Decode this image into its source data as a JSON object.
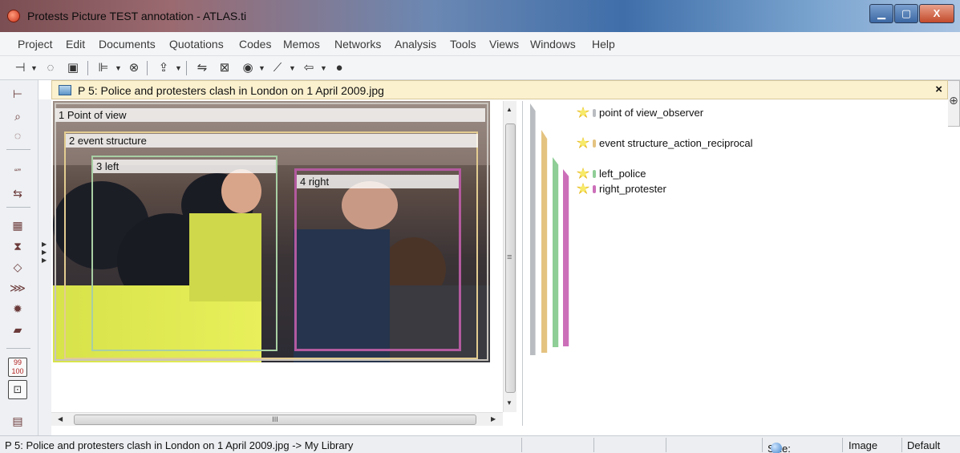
{
  "window": {
    "title": "Protests Picture TEST annotation - ATLAS.ti",
    "close_glyph": "X"
  },
  "menu": [
    "Project",
    "Edit",
    "Documents",
    "Quotations",
    "Codes",
    "Memos",
    "Networks",
    "Analysis",
    "Tools",
    "Views",
    "Windows",
    "Help"
  ],
  "document": {
    "title": "P 5: Police and protesters clash in London on 1 April 2009.jpg",
    "close": "×"
  },
  "regions": [
    {
      "label": "1 Point of view",
      "color": "#c9c4bd"
    },
    {
      "label": "2 event structure",
      "color": "#e3cc90"
    },
    {
      "label": "3 left",
      "color": "#a8cfa3"
    },
    {
      "label": "4 right",
      "color": "#b35a9f"
    }
  ],
  "codes": [
    {
      "label": "point of view_observer",
      "color": "#b9bcc0"
    },
    {
      "label": "event structure_action_reciprocal",
      "color": "#e4c381"
    },
    {
      "label": "left_police",
      "color": "#8fce96"
    },
    {
      "label": "right_protester",
      "color": "#cc6fb9"
    }
  ],
  "sidebar_counter": {
    "top": "99",
    "bottom": "100"
  },
  "scroll": {
    "h_grip": "III",
    "v_grip": "≡"
  },
  "status": {
    "path": "P 5: Police and protesters clash in London on 1 April 2009.jpg ->  My Library",
    "size": "Size: 100%",
    "type": "Image",
    "mode": "Default"
  }
}
